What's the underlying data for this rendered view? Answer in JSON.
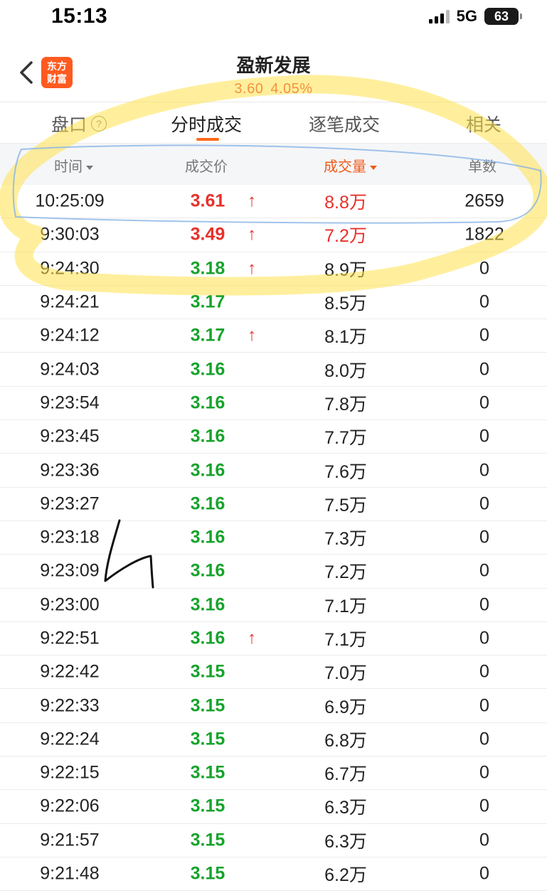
{
  "status_bar": {
    "time": "15:13",
    "network": "5G",
    "battery": "63"
  },
  "header": {
    "back_label": "‹",
    "logo_line1": "东方",
    "logo_line2": "财富",
    "title": "盈新发展",
    "price": "3.60",
    "change_pct": "4.05%"
  },
  "tabs": [
    {
      "label": "盘口",
      "has_help": true
    },
    {
      "label": "分时成交",
      "active": true
    },
    {
      "label": "逐笔成交"
    },
    {
      "label": "相关"
    }
  ],
  "columns": {
    "time": "时间",
    "price": "成交价",
    "volume": "成交量",
    "count": "单数"
  },
  "colors": {
    "up": "#e8302a",
    "down": "#16a32b",
    "accent": "#ff6a1a"
  },
  "rows": [
    {
      "time": "10:25:09",
      "price": "3.61",
      "dir": "up",
      "arrow": "↑",
      "volume": "8.8万",
      "vol_dir": "up",
      "count": "2659"
    },
    {
      "time": "9:30:03",
      "price": "3.49",
      "dir": "up",
      "arrow": "↑",
      "volume": "7.2万",
      "vol_dir": "up",
      "count": "1822"
    },
    {
      "time": "9:24:30",
      "price": "3.18",
      "dir": "down",
      "arrow": "↑",
      "volume": "8.9万",
      "vol_dir": "neutral",
      "count": "0"
    },
    {
      "time": "9:24:21",
      "price": "3.17",
      "dir": "down",
      "arrow": "",
      "volume": "8.5万",
      "vol_dir": "neutral",
      "count": "0"
    },
    {
      "time": "9:24:12",
      "price": "3.17",
      "dir": "down",
      "arrow": "↑",
      "volume": "8.1万",
      "vol_dir": "neutral",
      "count": "0"
    },
    {
      "time": "9:24:03",
      "price": "3.16",
      "dir": "down",
      "arrow": "",
      "volume": "8.0万",
      "vol_dir": "neutral",
      "count": "0"
    },
    {
      "time": "9:23:54",
      "price": "3.16",
      "dir": "down",
      "arrow": "",
      "volume": "7.8万",
      "vol_dir": "neutral",
      "count": "0"
    },
    {
      "time": "9:23:45",
      "price": "3.16",
      "dir": "down",
      "arrow": "",
      "volume": "7.7万",
      "vol_dir": "neutral",
      "count": "0"
    },
    {
      "time": "9:23:36",
      "price": "3.16",
      "dir": "down",
      "arrow": "",
      "volume": "7.6万",
      "vol_dir": "neutral",
      "count": "0"
    },
    {
      "time": "9:23:27",
      "price": "3.16",
      "dir": "down",
      "arrow": "",
      "volume": "7.5万",
      "vol_dir": "neutral",
      "count": "0"
    },
    {
      "time": "9:23:18",
      "price": "3.16",
      "dir": "down",
      "arrow": "",
      "volume": "7.3万",
      "vol_dir": "neutral",
      "count": "0"
    },
    {
      "time": "9:23:09",
      "price": "3.16",
      "dir": "down",
      "arrow": "",
      "volume": "7.2万",
      "vol_dir": "neutral",
      "count": "0"
    },
    {
      "time": "9:23:00",
      "price": "3.16",
      "dir": "down",
      "arrow": "",
      "volume": "7.1万",
      "vol_dir": "neutral",
      "count": "0"
    },
    {
      "time": "9:22:51",
      "price": "3.16",
      "dir": "down",
      "arrow": "↑",
      "volume": "7.1万",
      "vol_dir": "neutral",
      "count": "0"
    },
    {
      "time": "9:22:42",
      "price": "3.15",
      "dir": "down",
      "arrow": "",
      "volume": "7.0万",
      "vol_dir": "neutral",
      "count": "0"
    },
    {
      "time": "9:22:33",
      "price": "3.15",
      "dir": "down",
      "arrow": "",
      "volume": "6.9万",
      "vol_dir": "neutral",
      "count": "0"
    },
    {
      "time": "9:22:24",
      "price": "3.15",
      "dir": "down",
      "arrow": "",
      "volume": "6.8万",
      "vol_dir": "neutral",
      "count": "0"
    },
    {
      "time": "9:22:15",
      "price": "3.15",
      "dir": "down",
      "arrow": "",
      "volume": "6.7万",
      "vol_dir": "neutral",
      "count": "0"
    },
    {
      "time": "9:22:06",
      "price": "3.15",
      "dir": "down",
      "arrow": "",
      "volume": "6.3万",
      "vol_dir": "neutral",
      "count": "0"
    },
    {
      "time": "9:21:57",
      "price": "3.15",
      "dir": "down",
      "arrow": "",
      "volume": "6.3万",
      "vol_dir": "neutral",
      "count": "0"
    },
    {
      "time": "9:21:48",
      "price": "3.15",
      "dir": "down",
      "arrow": "",
      "volume": "6.2万",
      "vol_dir": "neutral",
      "count": "0"
    }
  ]
}
